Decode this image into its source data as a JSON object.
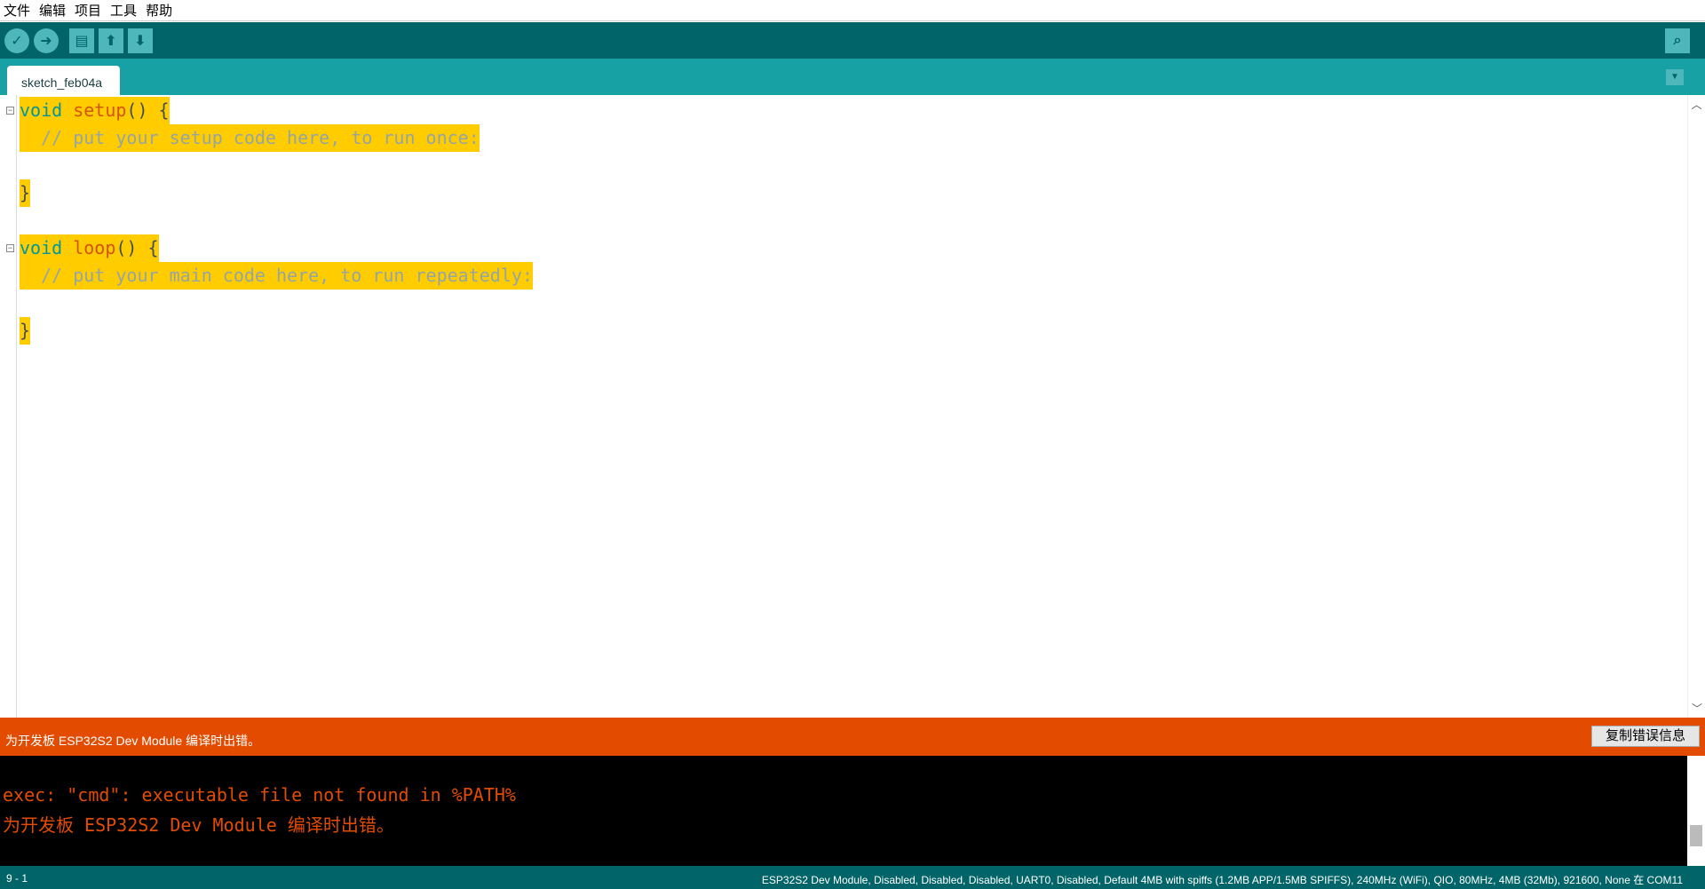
{
  "menu": [
    "文件",
    "编辑",
    "项目",
    "工具",
    "帮助"
  ],
  "toolbar": {
    "verify": "✓",
    "upload": "➜",
    "new": "▤",
    "open": "⬆",
    "save": "⬇",
    "serial": "⌕"
  },
  "tab": {
    "name": "sketch_feb04a",
    "menu": "▼"
  },
  "code": {
    "l1kw": "void",
    "l1fn": " setup",
    "l1rest": "() {",
    "l2": "  // put your setup code here, to run once:",
    "l4": "}",
    "l6kw": "void",
    "l6fn": " loop",
    "l6rest": "() {",
    "l7": "  // put your main code here, to run repeatedly:",
    "l9": "}"
  },
  "message": {
    "text": "为开发板 ESP32S2 Dev Module 编译时出错。",
    "copy_button": "复制错误信息"
  },
  "console": [
    "exec: \"cmd\": executable file not found in %PATH%",
    "为开发板 ESP32S2 Dev Module 编译时出错。"
  ],
  "status": {
    "position": "9 - 1",
    "board": "ESP32S2 Dev Module, Disabled, Disabled, Disabled, UART0, Disabled, Default 4MB with spiffs (1.2MB APP/1.5MB SPIFFS), 240MHz (WiFi), QIO, 80MHz, 4MB (32Mb), 921600, None 在 COM11"
  },
  "colors": {
    "toolbar": "#006468",
    "tabbar": "#17a1a5",
    "error": "#e34c00",
    "highlight": "#ffcc00"
  }
}
